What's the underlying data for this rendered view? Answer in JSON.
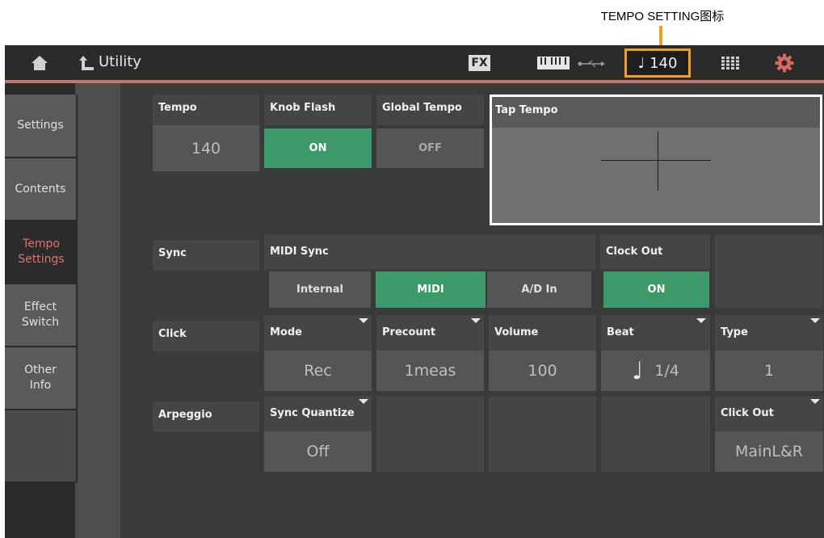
{
  "annotation": {
    "label": "TEMPO SETTING图标",
    "color": "#f0a020"
  },
  "topbar": {
    "title": "Utility",
    "fx_label": "FX",
    "tempo_note": "♩",
    "tempo_value": "140",
    "icons": [
      "home-icon",
      "up-arrow-icon",
      "keyboard-icon",
      "usb-icon",
      "grid-icon",
      "gear-icon"
    ]
  },
  "sidebar": {
    "items": [
      {
        "label": "Settings",
        "active": false
      },
      {
        "label": "Contents",
        "active": false
      },
      {
        "label": "Tempo\nSettings",
        "active": true
      },
      {
        "label": "Effect\nSwitch",
        "active": false
      },
      {
        "label": "Other\nInfo",
        "active": false
      }
    ],
    "active_color": "#e0726c"
  },
  "tempo": {
    "label": "Tempo",
    "value": "140"
  },
  "knob_flash": {
    "label": "Knob Flash",
    "value": "ON"
  },
  "global_tempo": {
    "label": "Global Tempo",
    "value": "OFF"
  },
  "tap_tempo": {
    "label": "Tap Tempo"
  },
  "sync": {
    "row_label": "Sync",
    "midi_sync_label": "MIDI Sync",
    "options": [
      "Internal",
      "MIDI",
      "A/D In"
    ],
    "selected": "MIDI",
    "clock_out_label": "Clock Out",
    "clock_out_value": "ON"
  },
  "click": {
    "row_label": "Click",
    "mode": {
      "label": "Mode",
      "value": "Rec"
    },
    "precount": {
      "label": "Precount",
      "value": "1meas"
    },
    "volume": {
      "label": "Volume",
      "value": "100"
    },
    "beat": {
      "label": "Beat",
      "note": "♩",
      "value": "1/4"
    },
    "type": {
      "label": "Type",
      "value": "1"
    }
  },
  "arpeggio": {
    "row_label": "Arpeggio",
    "sync_quantize": {
      "label": "Sync Quantize",
      "value": "Off"
    },
    "click_out": {
      "label": "Click Out",
      "value": "MainL&R"
    }
  },
  "colors": {
    "on_green": "#3c9a6a",
    "highlight_orange": "#f0a020"
  }
}
